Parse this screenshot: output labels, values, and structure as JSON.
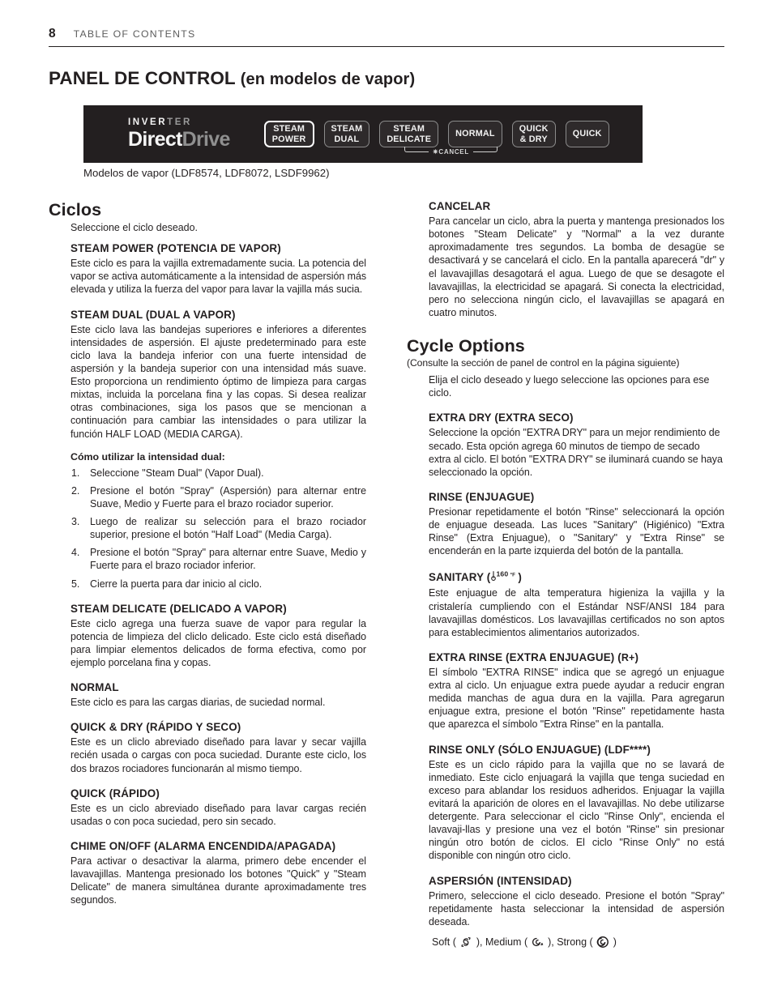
{
  "header": {
    "page_number": "8",
    "title": "TABLE OF CONTENTS"
  },
  "main_title": {
    "bold": "PANEL DE CONTROL",
    "paren": "(en modelos de vapor)"
  },
  "control_panel": {
    "brand_top": "INVERTER",
    "brand_top_part1": "INVER",
    "brand_top_part2": "TER",
    "brand_main_part1": "Direct",
    "brand_main_part2": "Drive",
    "buttons": [
      {
        "line1": "STEAM",
        "line2": "POWER",
        "highlight": true
      },
      {
        "line1": "STEAM",
        "line2": "DUAL",
        "highlight": false
      },
      {
        "line1": "STEAM",
        "line2": "DELICATE",
        "highlight": false
      },
      {
        "line1": "NORMAL",
        "line2": "",
        "highlight": false
      },
      {
        "line1": "QUICK",
        "line2": "& DRY",
        "highlight": false
      },
      {
        "line1": "QUICK",
        "line2": "",
        "highlight": false
      }
    ],
    "cancel_label": "✷CANCEL",
    "caption": "Modelos de vapor (LDF8574, LDF8072, LSDF9962)"
  },
  "left_column": {
    "section_title": "Ciclos",
    "section_lead": "Seleccione el ciclo deseado.",
    "entries": [
      {
        "heading": "STEAM POWER (POTENCIA DE VAPOR)",
        "body": "Este ciclo es para la vajilla extremadamente sucia. La potencia del vapor se activa automáticamente a la intensidad de aspersión más elevada y utiliza la fuerza del vapor para lavar la vajilla más sucia."
      },
      {
        "heading": "STEAM DUAL (DUAL A VAPOR)",
        "body": "Este ciclo lava las bandejas superiores e inferiores a diferentes intensidades de aspersión. El ajuste predeterminado para este ciclo lava la bandeja inferior con una fuerte intensidad de aspersión y la bandeja superior con una intensidad más suave. Esto proporciona un rendimiento óptimo de limpieza para cargas mixtas, incluida la porcelana fina y las copas. Si desea realizar otras combinaciones, siga los pasos que se mencionan a continuación para cambiar las intensidades o para utilizar la función HALF LOAD (MEDIA CARGA)."
      },
      {
        "heading": "STEAM DELICATE (DELICADO A VAPOR)",
        "body": "Este ciclo agrega una fuerza suave de vapor para regular la potencia de limpieza del cliclo delicado. Este ciclo está diseñado para limpiar elementos delicados de forma efectiva, como por ejemplo porcelana fina y copas."
      },
      {
        "heading": "NORMAL",
        "body": "Este ciclo es para las cargas diarias, de suciedad normal."
      },
      {
        "heading": "QUICK & DRY (RÁPIDO Y SECO)",
        "body": "Este es un cliclo abreviado diseñado para lavar y secar vajilla recién usada o cargas con poca suciedad. Durante este ciclo, los dos brazos rociadores funcionarán al mismo tiempo."
      },
      {
        "heading": "QUICK (RÁPIDO)",
        "body": "Este es un ciclo abreviado diseñado para lavar cargas recién usadas o con poca suciedad, pero sin secado."
      },
      {
        "heading": "CHIME ON/OFF (ALARMA ENCENDIDA/APAGADA)",
        "body": "Para activar o desactivar la alarma, primero debe encender el lavavajillas. Mantenga presionado los botones \"Quick\" y \"Steam Delicate\" de manera simultánea durante aproximadamente tres segundos."
      }
    ],
    "dual_howto_title": "Cómo utilizar la intensidad dual:",
    "dual_steps": [
      "Seleccione \"Steam Dual\" (Vapor Dual).",
      "Presione el botón \"Spray\" (Aspersión) para alternar entre Suave, Medio y Fuerte para el brazo rociador superior.",
      "Luego de realizar su selección para el brazo rociador superior, presione el botón \"Half Load\" (Media Carga).",
      "Presione el botón \"Spray\" para alternar entre Suave, Medio y Fuerte para el brazo rociador inferior.",
      "Cierre la puerta para dar inicio al ciclo."
    ]
  },
  "right_column": {
    "cancel_heading": "CANCELAR",
    "cancel_body": "Para cancelar un ciclo, abra la puerta y mantenga presionados los botones \"Steam Delicate\" y \"Normal\" a la vez durante aproximadamente tres segundos. La bomba de desagüe se desactivará y se cancelará el ciclo. En la pantalla aparecerá \"dr\" y el lavavajillas desagotará el agua. Luego de que se desagote el lavavajillas, la electricidad se apagará. Si conecta la electricidad, pero no selecciona ningún ciclo, el lavavajillas se apagará en cuatro minutos.",
    "section_title": "Cycle Options",
    "section_note": "(Consulte la sección de panel de control en la página siguiente)",
    "section_lead": "Elija el ciclo deseado y luego seleccione las opciones para ese ciclo.",
    "entries": [
      {
        "heading": "EXTRA DRY (EXTRA SECO)",
        "body": "Seleccione la opción \"EXTRA DRY\" para un mejor rendimiento de secado. Esta opción agrega 60 minutos de tiempo de secado extra al ciclo. El botón \"EXTRA DRY\" se iluminará cuando se haya seleccionado la opción."
      },
      {
        "heading": "RINSE (ENJUAGUE)",
        "body": "Presionar repetidamente el botón \"Rinse\" seleccionará la opción de enjuague deseada. Las luces \"Sanitary\" (Higiénico) \"Extra Rinse\" (Extra Enjuague), o \"Sanitary\" y \"Extra Rinse\" se encenderán en la parte izquierda del botón de la pantalla."
      },
      {
        "heading": "SANITARY (",
        "heading_suffix": ")",
        "icon": "thermometer-160f-icon",
        "icon_text": "160°F",
        "body": "Este enjuague de alta temperatura higieniza la vajilla y la cristalería cumpliendo con el Estándar NSF/ANSI 184 para lavavajillas domésticos. Los lavavajillas certificados no son aptos para establecimientos alimentarios autorizados."
      },
      {
        "heading": "EXTRA RINSE (EXTRA ENJUAGUE) (",
        "heading_suffix": ")",
        "icon": "r-plus-icon",
        "icon_text": "R+",
        "body": "El símbolo \"EXTRA RINSE\" indica que se agregó un enjuague extra al ciclo. Un enjuague extra puede ayudar a reducir engran medida manchas de agua dura en la vajilla. Para agregarun enjuague extra, presione el botón \"Rinse\" repetidamente hasta que aparezca el símbolo \"Extra Rinse\" en la pantalla."
      },
      {
        "heading": "RINSE ONLY (SÓLO ENJUAGUE) (LDF****)",
        "body": "Este es un ciclo rápido para la vajilla que no se lavará de inmediato. Este ciclo enjuagará la vajilla que tenga suciedad en exceso para ablandar los residuos adheridos. Enjuagar la vajilla evitará la aparición de olores en el lavavajillas. No debe utilizarse detergente. Para seleccionar el ciclo \"Rinse Only\", encienda el lavavaji-llas y presione una vez el botón \"Rinse\" sin presionar ningún otro botón de ciclos. El ciclo \"Rinse Only\" no está disponible con ningún otro ciclo."
      },
      {
        "heading": "ASPERSIÓN (INTENSIDAD)",
        "body": "Primero, seleccione el ciclo deseado. Presione el botón \"Spray\" repetidamente hasta seleccionar la intensidad de aspersión deseada."
      }
    ],
    "spray_levels": [
      {
        "label": "Soft",
        "icon": "spray-soft-spiral-icon"
      },
      {
        "label": "Medium",
        "icon": "spray-medium-spiral-icon"
      },
      {
        "label": "Strong",
        "icon": "spray-strong-spiral-icon"
      }
    ],
    "spray_open": "(",
    "spray_close": ")",
    "spray_sep": ", "
  }
}
